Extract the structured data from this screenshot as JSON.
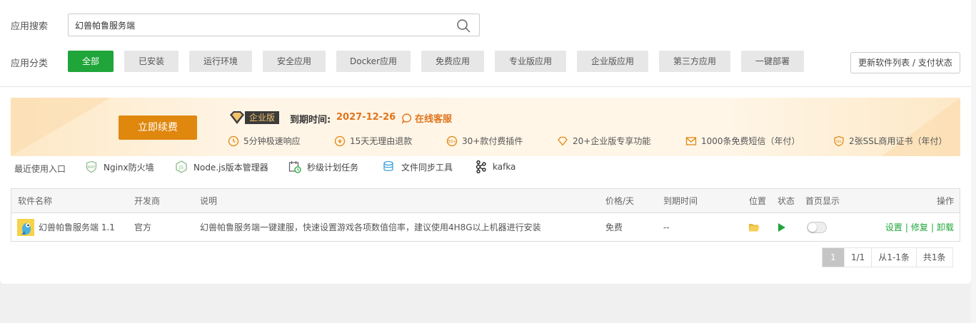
{
  "search": {
    "label": "应用搜索",
    "value": "幻兽帕鲁服务端"
  },
  "categories": {
    "label": "应用分类",
    "items": [
      "全部",
      "已安装",
      "运行环境",
      "安全应用",
      "Docker应用",
      "免费应用",
      "专业版应用",
      "企业版应用",
      "第三方应用",
      "一键部署"
    ],
    "active_index": 0,
    "refresh_label": "更新软件列表 / 支付状态"
  },
  "banner": {
    "renew_label": "立即续费",
    "edition_tag": "企业版",
    "expire_label": "到期时间:",
    "expire_date": "2027-12-26",
    "service_label": "在线客服",
    "perks": [
      "5分钟极速响应",
      "15天无理由退款",
      "30+款付费插件",
      "20+企业版专享功能",
      "1000条免费短信（年付）",
      "2张SSL商用证书（年付）"
    ]
  },
  "recent": {
    "label": "最近使用入口",
    "items": [
      "Nginx防火墙",
      "Node.js版本管理器",
      "秒级计划任务",
      "文件同步工具",
      "kafka"
    ]
  },
  "table": {
    "headers": {
      "name": "软件名称",
      "vendor": "开发商",
      "desc": "说明",
      "price": "价格/天",
      "expire": "到期时间",
      "location": "位置",
      "status": "状态",
      "home": "首页显示",
      "ops": "操作"
    },
    "rows": [
      {
        "name": "幻兽帕鲁服务端 1.1",
        "vendor": "官方",
        "desc": "幻兽帕鲁服务端一键建服，快速设置游戏各项数值倍率，建议使用4H8G以上机器进行安装",
        "price": "免费",
        "expire": "--",
        "home_display": false,
        "ops": [
          "设置",
          "修复",
          "卸载"
        ]
      }
    ]
  },
  "pager": {
    "current": "1",
    "pages": "1/1",
    "range": "从1-1条",
    "total": "共1条"
  },
  "colors": {
    "primary": "#20a53a",
    "accent": "#e0870e",
    "highlight": "#e0741d"
  }
}
